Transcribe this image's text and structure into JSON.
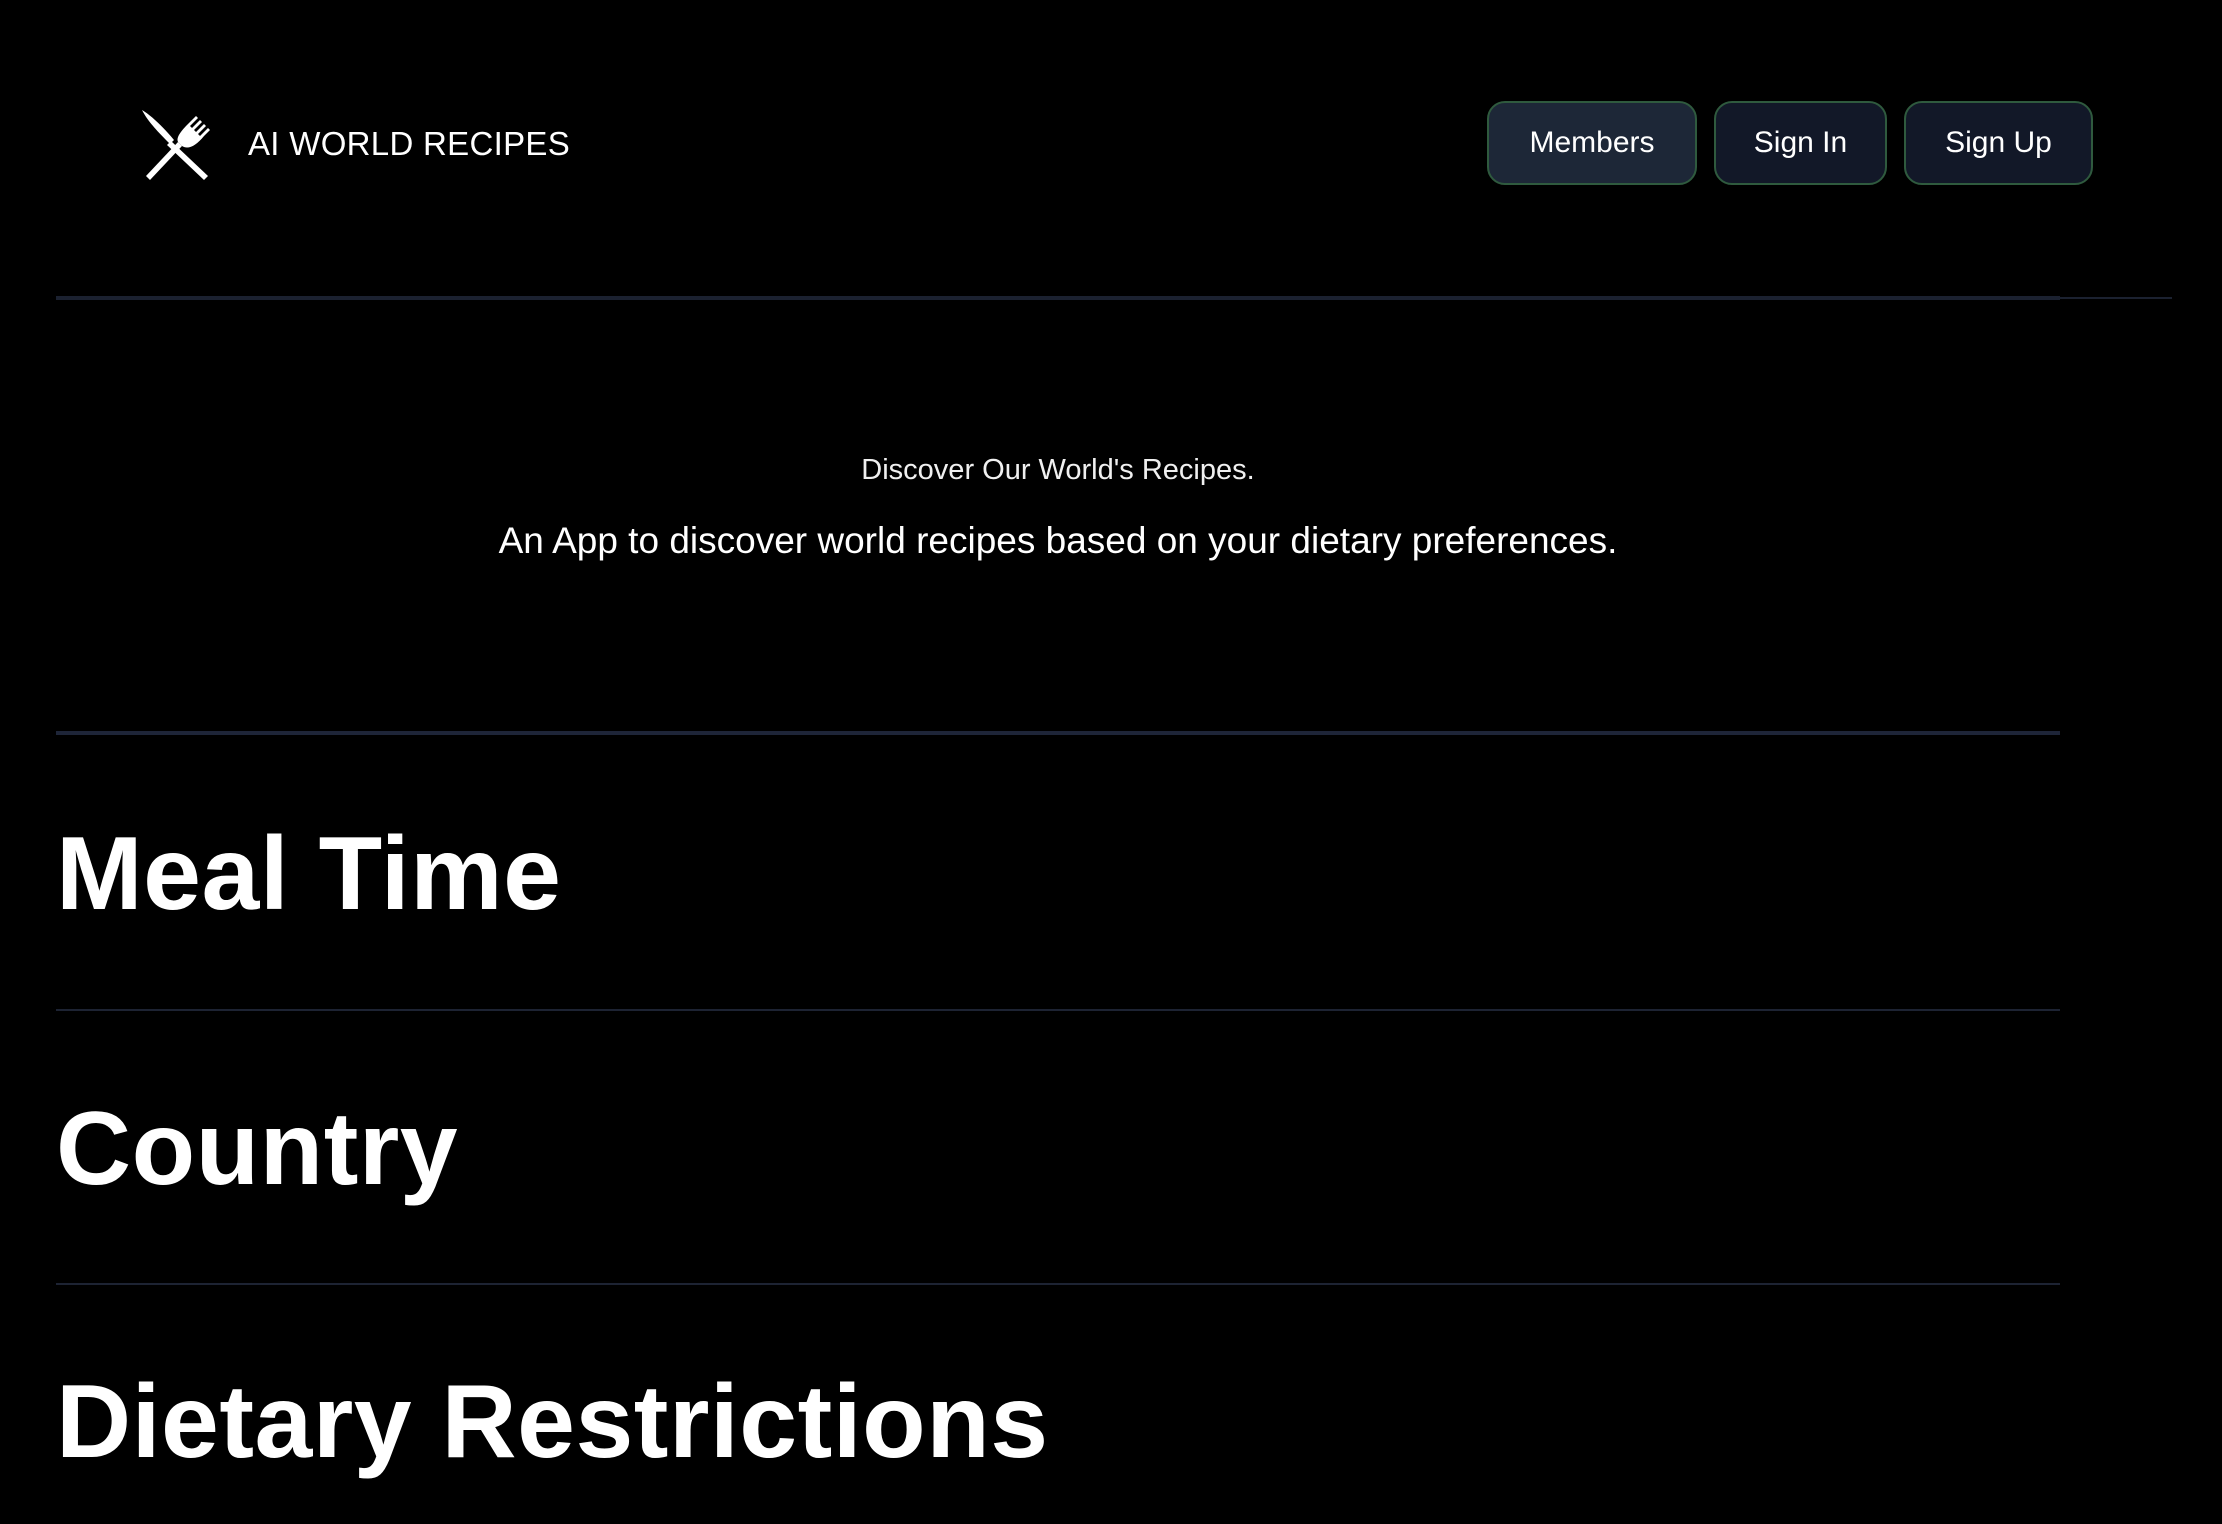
{
  "header": {
    "brand_name": "AI WORLD RECIPES",
    "brand_icon": "fork-knife-icon",
    "nav": {
      "members_label": "Members",
      "signin_label": "Sign In",
      "signup_label": "Sign Up"
    }
  },
  "hero": {
    "subtitle": "Discover Our World's Recipes.",
    "tagline": "An App to discover world recipes based on your dietary preferences."
  },
  "sections": [
    {
      "title": "Meal Time"
    },
    {
      "title": "Country"
    },
    {
      "title": "Dietary Restrictions"
    }
  ],
  "colors": {
    "background": "#000000",
    "text": "#ffffff",
    "button_bg": "#121828",
    "button_bg_active": "#1d2737",
    "button_border": "#2f5a3e",
    "divider": "#1d2333"
  }
}
